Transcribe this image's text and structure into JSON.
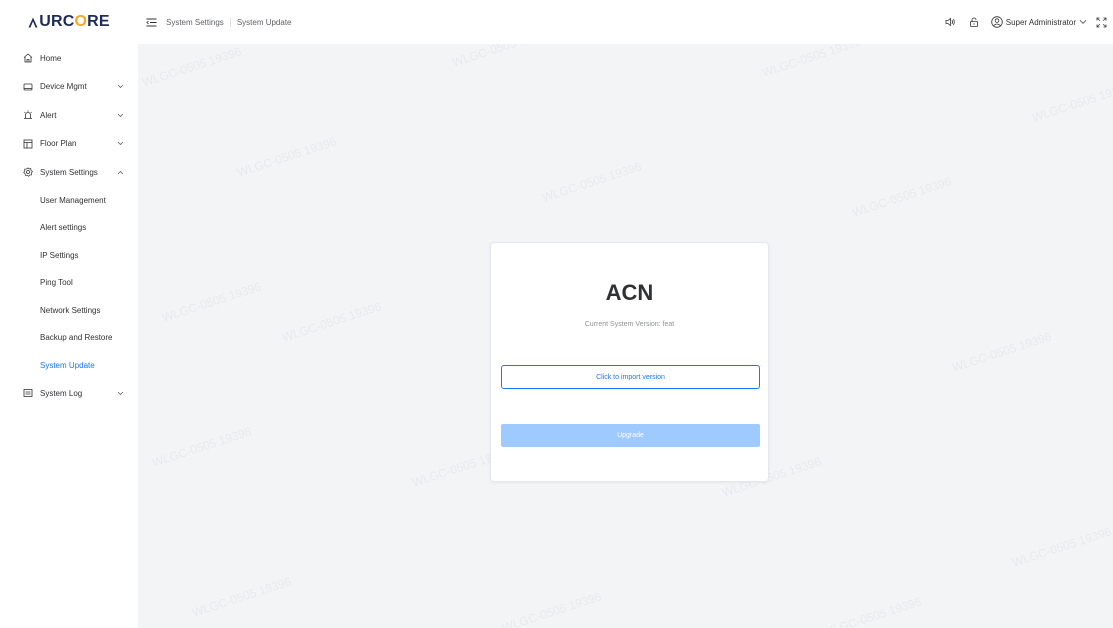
{
  "logo": {
    "prefix": "A",
    "mid": "URC",
    "o": "O",
    "suffix": "RE"
  },
  "header": {
    "breadcrumb": [
      "System Settings",
      "System Update"
    ],
    "user": "Super Administrator"
  },
  "sidebar": {
    "items": [
      {
        "label": "Home",
        "icon": "home-icon"
      },
      {
        "label": "Device Mgmt",
        "icon": "monitor-icon",
        "expandable": true
      },
      {
        "label": "Alert",
        "icon": "siren-icon",
        "expandable": true
      },
      {
        "label": "Floor Plan",
        "icon": "floor-plan-icon",
        "expandable": true
      },
      {
        "label": "System Settings",
        "icon": "gear-icon",
        "expanded": true
      },
      {
        "label": "System Log",
        "icon": "log-icon",
        "expandable": true
      }
    ],
    "sub_items": [
      "User Management",
      "Alert settings",
      "IP Settings",
      "Ping Tool",
      "Network Settings",
      "Backup and Restore",
      "System Update"
    ],
    "active_sub": "System Update"
  },
  "card": {
    "title": "ACN",
    "version_text": "Current System Version: feat",
    "import_label": "Click to import version",
    "upgrade_label": "Upgrade"
  },
  "watermark": "WLGC-0505 19396",
  "colors": {
    "accent": "#1677ff",
    "disabled": "#9fcaff",
    "logo_o": "#f7a823",
    "logo_text": "#1f2a5a"
  }
}
